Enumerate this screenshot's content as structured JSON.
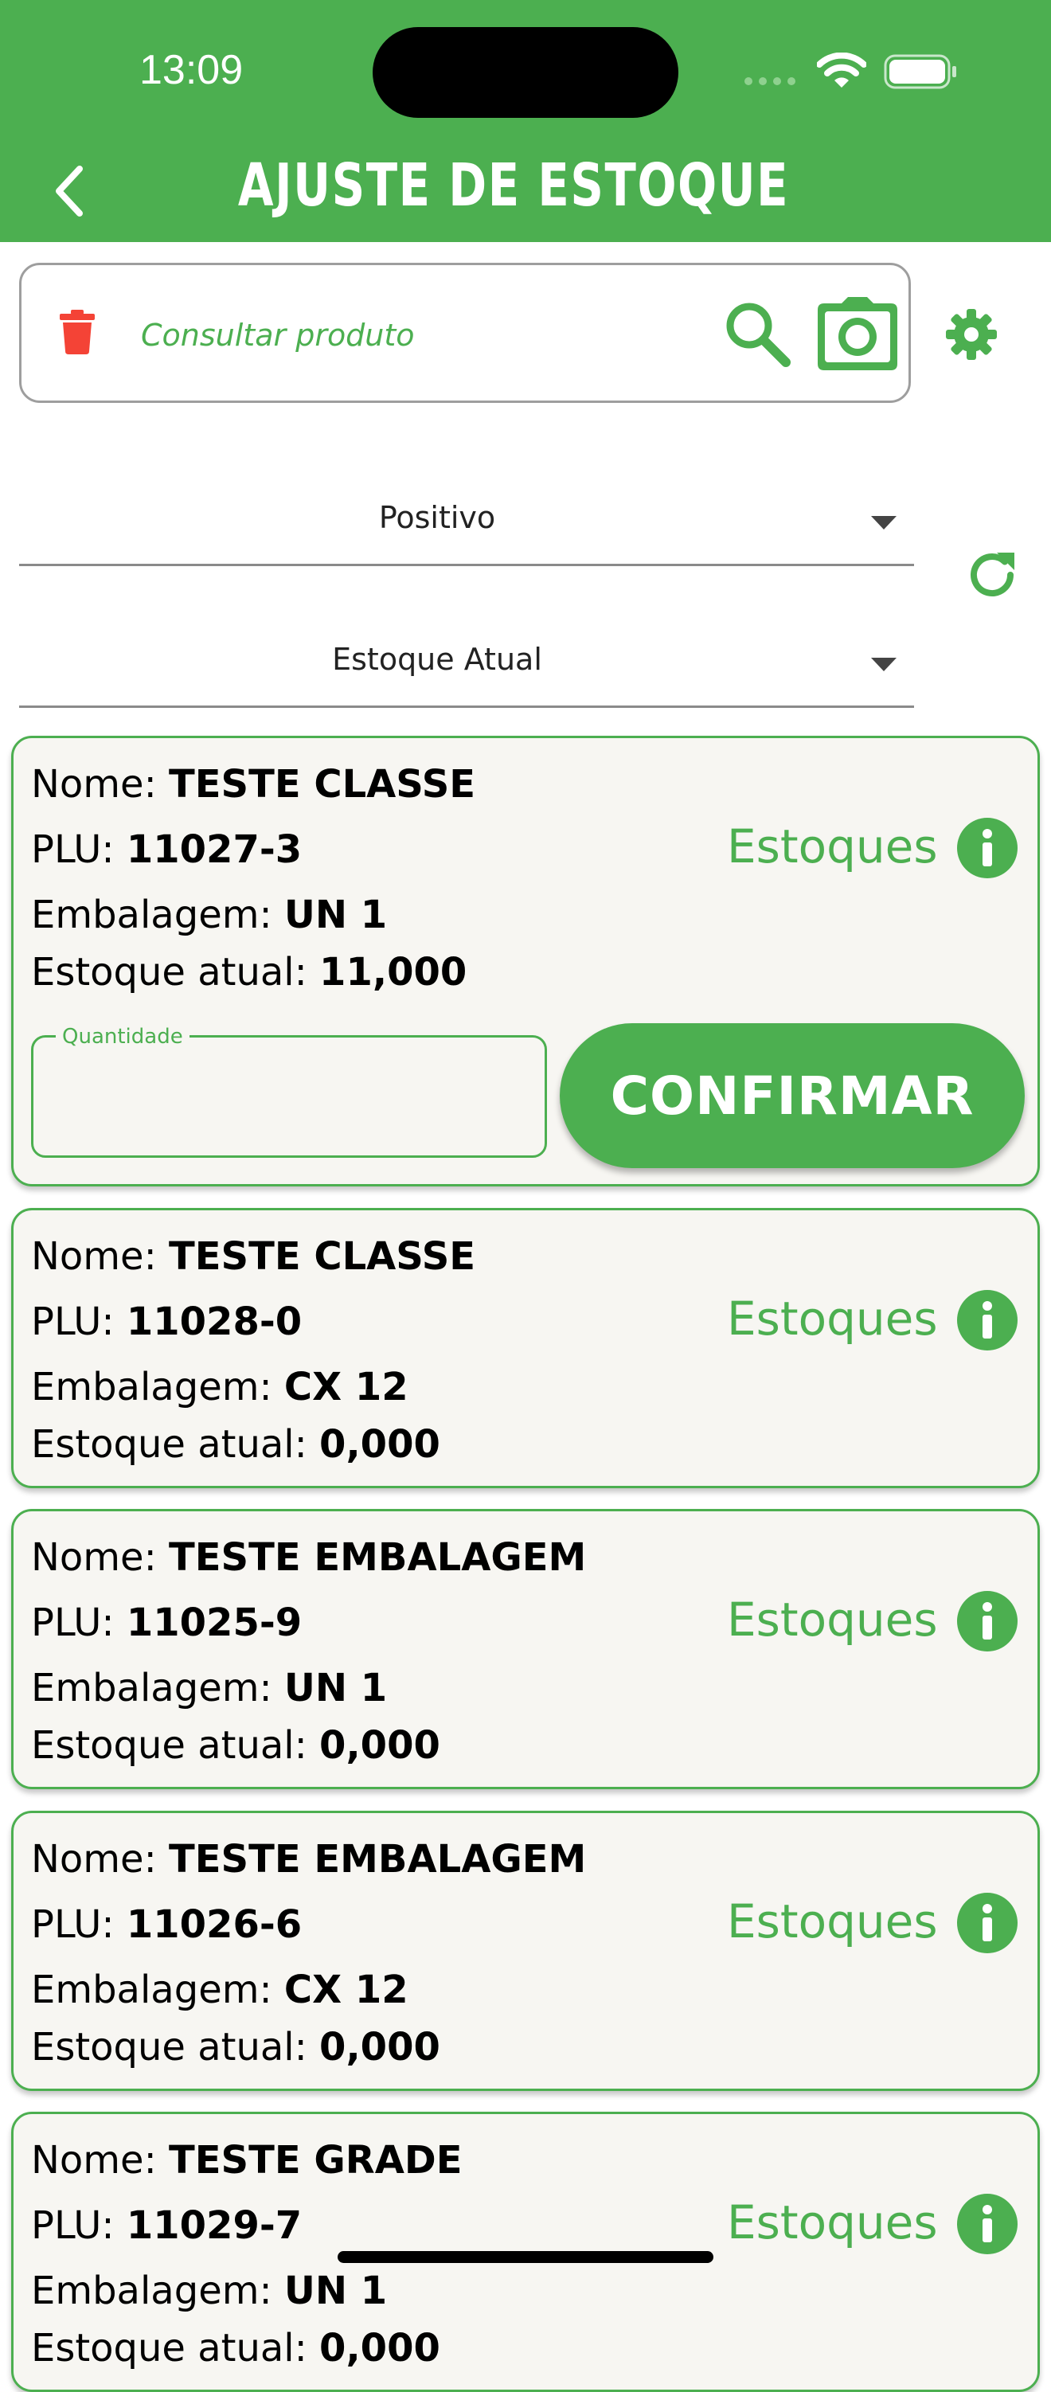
{
  "status_bar": {
    "time": "13:09"
  },
  "header": {
    "title": "AJUSTE DE ESTOQUE",
    "back_icon": "chevron-left-icon"
  },
  "search": {
    "placeholder": "Consultar produto",
    "icons": [
      "trash-icon",
      "search-icon",
      "camera-icon",
      "gear-icon"
    ]
  },
  "filters": {
    "type": {
      "value": "Positivo"
    },
    "stock": {
      "value": "Estoque Atual"
    },
    "refresh_icon": "refresh-icon"
  },
  "labels": {
    "name": "Nome: ",
    "plu": "PLU: ",
    "package": "Embalagem: ",
    "stock": "Estoque atual: ",
    "stocks_link": "Estoques",
    "quantity": "Quantidade",
    "confirm": "CONFIRMAR"
  },
  "colors": {
    "accent": "#4caf50",
    "danger": "#f44336",
    "card_bg": "#f7f6f2"
  },
  "products": [
    {
      "name": "TESTE CLASSE",
      "plu": "11027-3",
      "package": "UN 1",
      "stock": "11,000",
      "quantity_value": ""
    },
    {
      "name": "TESTE CLASSE",
      "plu": "11028-0",
      "package": "CX 12",
      "stock": "0,000"
    },
    {
      "name": "TESTE EMBALAGEM",
      "plu": "11025-9",
      "package": "UN 1",
      "stock": "0,000"
    },
    {
      "name": "TESTE EMBALAGEM",
      "plu": "11026-6",
      "package": "CX 12",
      "stock": "0,000"
    },
    {
      "name": "TESTE GRADE",
      "plu": "11029-7",
      "package": "UN 1",
      "stock": "0,000"
    }
  ]
}
